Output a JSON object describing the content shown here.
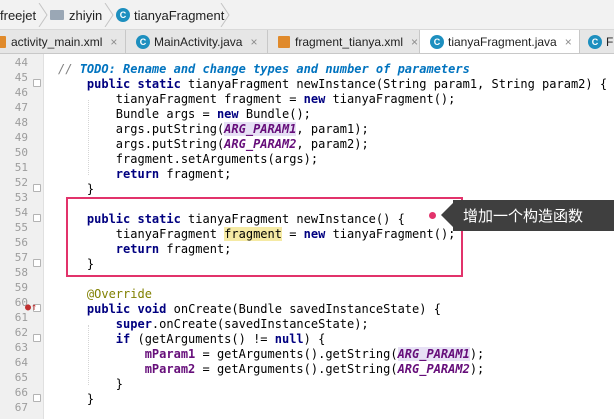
{
  "breadcrumb": {
    "items": [
      {
        "label": "freejet",
        "icon": "folder-icon"
      },
      {
        "label": "zhiyin",
        "icon": "folder-icon"
      },
      {
        "label": "tianyaFragment",
        "icon": "class-icon"
      }
    ]
  },
  "tabs": [
    {
      "label": "activity_main.xml",
      "icon": "xml-file-icon",
      "active": false
    },
    {
      "label": "MainActivity.java",
      "icon": "class-icon",
      "active": false
    },
    {
      "label": "fragment_tianya.xml",
      "icon": "xml-file-icon",
      "active": false
    },
    {
      "label": "tianyaFragment.java",
      "icon": "class-icon",
      "active": true
    },
    {
      "label": "Fr",
      "icon": "class-icon",
      "active": false
    }
  ],
  "editor": {
    "line_numbers": [
      "44",
      "45",
      "46",
      "47",
      "48",
      "49",
      "50",
      "51",
      "52",
      "53",
      "54",
      "55",
      "56",
      "57",
      "58",
      "59",
      "60",
      "61",
      "62",
      "63",
      "64",
      "65",
      "66",
      "67"
    ],
    "lines": [
      "    // TODO: Rename and change types and number of parameters",
      "    public static tianyaFragment newInstance(String param1, String param2) {",
      "        tianyaFragment fragment = new tianyaFragment();",
      "        Bundle args = new Bundle();",
      "        args.putString(ARG_PARAM1, param1);",
      "        args.putString(ARG_PARAM2, param2);",
      "        fragment.setArguments(args);",
      "        return fragment;",
      "    }",
      "",
      "    public static tianyaFragment newInstance() {",
      "        tianyaFragment fragment = new tianyaFragment();",
      "        return fragment;",
      "    }",
      "",
      "    @Override",
      "    public void onCreate(Bundle savedInstanceState) {",
      "        super.onCreate(savedInstanceState);",
      "        if (getArguments() != null) {",
      "            mParam1 = getArguments().getString(ARG_PARAM1);",
      "            mParam2 = getArguments().getString(ARG_PARAM2);",
      "        }",
      "    }",
      ""
    ]
  },
  "annotation": {
    "callout_text": "增加一个构造函数",
    "highlight_color": "#e2336b"
  }
}
